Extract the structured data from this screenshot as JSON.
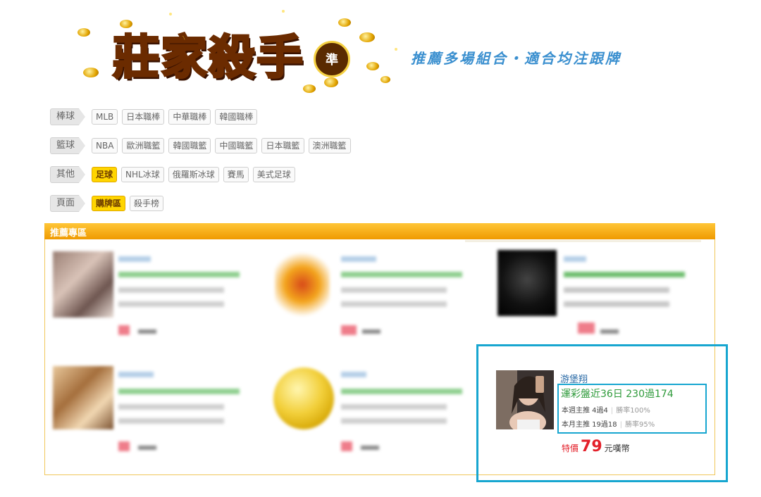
{
  "header": {
    "logo_text": "莊家殺手",
    "logo_badge": "準",
    "tagline": "推薦多場組合・適合均注跟牌"
  },
  "nav": [
    {
      "category": "棒球",
      "tags": [
        "MLB",
        "日本職棒",
        "中華職棒",
        "韓國職棒"
      ],
      "active": []
    },
    {
      "category": "籃球",
      "tags": [
        "NBA",
        "歐洲職籃",
        "韓國職籃",
        "中國職籃",
        "日本職籃",
        "澳洲職籃"
      ],
      "active": []
    },
    {
      "category": "其他",
      "tags": [
        "足球",
        "NHL冰球",
        "俄羅斯冰球",
        "賽馬",
        "美式足球"
      ],
      "active": [
        0
      ]
    },
    {
      "category": "頁面",
      "tags": [
        "購牌區",
        "殺手榜"
      ],
      "active": [
        0
      ]
    }
  ],
  "panel": {
    "title": "推薦專區",
    "featured": {
      "name": "游堡翔",
      "record": "運彩盤近36日 230過174",
      "week_label": "本週主推 4過4",
      "week_rate": "勝率100%",
      "month_label": "本月主推 19過18",
      "month_rate": "勝率95%",
      "price_prefix": "特價",
      "price_value": "79",
      "price_unit": "元嘆幣"
    }
  },
  "colors": {
    "panel_header": "#ef9a00",
    "highlight_border": "#17a6d0",
    "record_green": "#2e9a3a",
    "price_red": "#e3202a",
    "active_tag": "#ffd500"
  }
}
